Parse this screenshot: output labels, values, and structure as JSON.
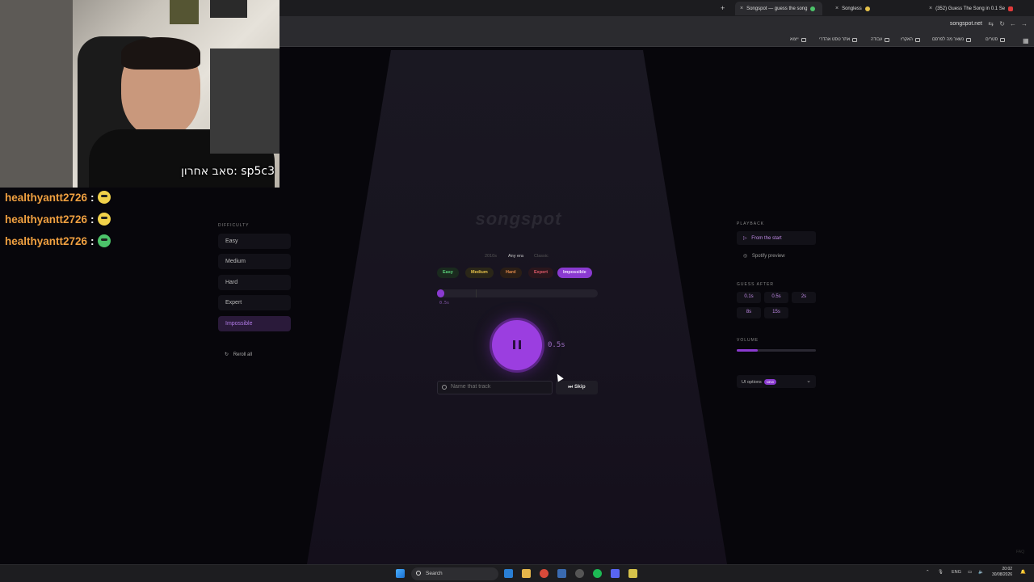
{
  "browser": {
    "tabs": [
      {
        "label": "Songspot — guess the song"
      },
      {
        "label": "Songless"
      },
      {
        "label": "(352) Guess The Song in 0.1 Se"
      }
    ],
    "url": "songspot.net",
    "bookmarks": [
      "ייצוא",
      "אתר טסט אהדרי",
      "עבודה",
      "האקרז",
      "נשאר מה לפרסם",
      "סטרים"
    ]
  },
  "webcam": {
    "overlay_text": "סאב אחרון: sp5c3"
  },
  "chat": [
    {
      "user": "healthyantt2726",
      "sep": ":",
      "emote": "yellow-face-emote"
    },
    {
      "user": "healthyantt2726",
      "sep": ":",
      "emote": "yellow-face-emote"
    },
    {
      "user": "healthyantt2726",
      "sep": ":",
      "emote": "green-face-emote"
    }
  ],
  "left_panel": {
    "heading": "DIFFICULTY",
    "items": [
      "Easy",
      "Medium",
      "Hard",
      "Expert",
      "Impossible"
    ],
    "active": "Impossible",
    "reroll": "Reroll all"
  },
  "main": {
    "logo": "songspot",
    "eras": [
      "2010s",
      "Any era",
      "Classic"
    ],
    "active_era": "Any era",
    "difficulties": [
      {
        "label": "Easy",
        "color": "#5ad07a"
      },
      {
        "label": "Medium",
        "color": "#e6c24a"
      },
      {
        "label": "Hard",
        "color": "#e0894a"
      },
      {
        "label": "Expert",
        "color": "#e05a6a"
      },
      {
        "label": "Impossible",
        "color": "#b07ae6"
      }
    ],
    "active_difficulty": "Impossible",
    "progress_label": "0.5s",
    "progress_fraction": 0.045,
    "time": "0.5s",
    "search_placeholder": "Name that track",
    "skip_label": "Skip"
  },
  "right_panel": {
    "playback_heading": "PLAYBACK",
    "from_start": "From the start",
    "spotify_preview": "Spotify preview",
    "guess_after_heading": "GUESS AFTER",
    "guess_after": [
      "0.1s",
      "0.5s",
      "2s",
      "8s",
      "15s"
    ],
    "volume_heading": "VOLUME",
    "volume_fraction": 0.27,
    "ui_options": "UI options",
    "new_badge": "NEW"
  },
  "footer": {
    "faq": "FAQ"
  },
  "taskbar": {
    "search": "Search",
    "lang": "ENG",
    "time": "20:02",
    "date": "30/08/2026"
  },
  "colors": {
    "accent": "#9b3ee0",
    "background": "#07060b"
  }
}
